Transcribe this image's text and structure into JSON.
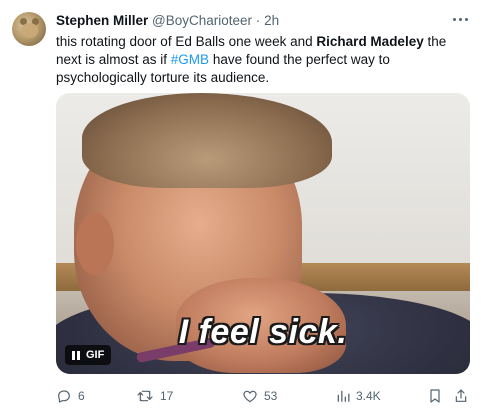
{
  "tweet": {
    "author_name": "Stephen Miller",
    "handle": "@BoyCharioteer",
    "separator": "·",
    "time": "2h",
    "text_parts": [
      "this rotating door of Ed Balls one week and ",
      "Richard Madeley",
      " the next is almost as if ",
      "#GMB",
      " have found the perfect way to psychologically torture its audience."
    ]
  },
  "media": {
    "caption": "I feel sick.",
    "badge_label": "GIF",
    "badge_icon": "pause-icon"
  },
  "actions": {
    "reply_count": "6",
    "retweet_count": "17",
    "like_count": "53",
    "views_count": "3.4K"
  },
  "colors": {
    "accent": "#1d9bf0",
    "muted": "#536471",
    "text": "#0f1419"
  }
}
